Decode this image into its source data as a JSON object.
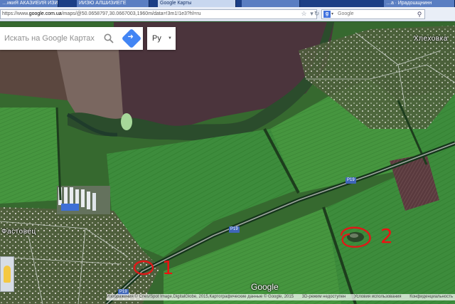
{
  "browser": {
    "tabs": [
      {
        "label": "…икиЯ АКАЗИЕИЯ ИЗИ"
      },
      {
        "label": "ИИЗЮ АЛШИЗИЕГЕ"
      },
      {
        "label": "Google Карты"
      },
      {
        "label": ""
      },
      {
        "label": "…а ∙ Ирадошщнинн"
      }
    ],
    "url_prefix": "https://www.",
    "url_domain": "google.com.ua",
    "url_path": "/maps/@50.0658797,30.0667003,1960m/data=!3m1!1e3?hl=ru",
    "search_engine_placeholder": "Google"
  },
  "maps": {
    "search_placeholder": "Искать на Google Картах",
    "language": "Ру",
    "place_labels": {
      "top_right": "Хлеховка",
      "left": "Фастовец"
    },
    "road_shields": [
      "P19",
      "P19",
      "P19"
    ],
    "logo": "Google",
    "attribution": [
      "Изображения © Cnes/Spot Image,DigitalGlobe, 2015,Картографические данные © Google, 2015",
      "3D-режим недоступен",
      "Условия использования",
      "Конфиденциальность"
    ]
  },
  "annotations": {
    "marker_1": "1",
    "marker_2": "2",
    "color": "#e01818"
  }
}
